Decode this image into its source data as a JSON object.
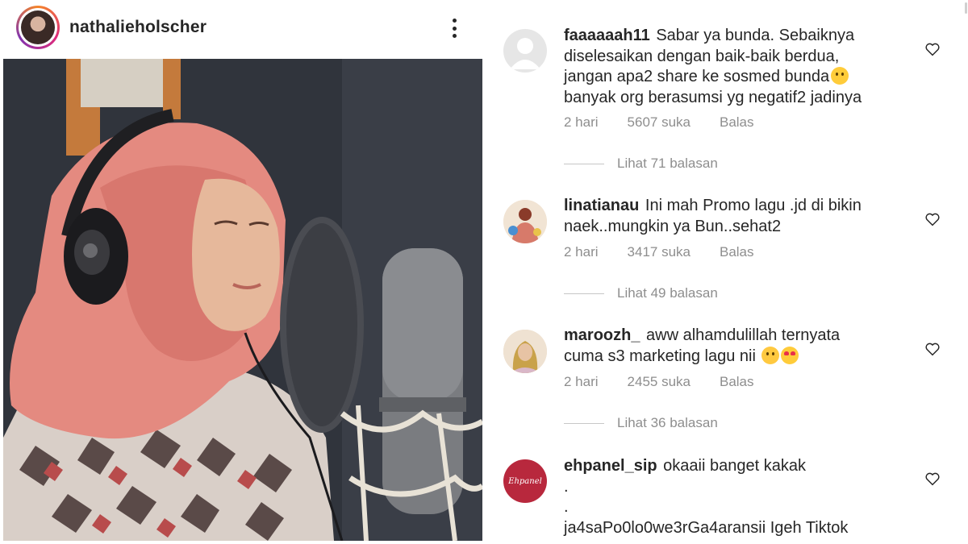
{
  "post": {
    "author": "nathalieholscher",
    "icons": {
      "more": "more-vertical-icon",
      "like": "heart-outline-icon"
    }
  },
  "comments": [
    {
      "user": "faaaaaah11",
      "text_lines": [
        "Sabar ya bunda. Sebaiknya",
        "diselesaikan dengan baik-baik berdua,",
        "jangan apa2 share ke sosmed bunda",
        "banyak org berasumsi yg negatif2 jadinya"
      ],
      "time": "2 hari",
      "likes": "5607 suka",
      "reply": "Balas",
      "view_replies": "Lihat 71 balasan"
    },
    {
      "user": "linatianau",
      "text_lines": [
        "Ini mah Promo lagu .jd di bikin",
        "naek..mungkin ya Bun..sehat2"
      ],
      "time": "2 hari",
      "likes": "3417 suka",
      "reply": "Balas",
      "view_replies": "Lihat 49 balasan"
    },
    {
      "user": "maroozh_",
      "text_lines": [
        "aww alhamdulillah ternyata",
        "cuma s3 marketing lagu nii"
      ],
      "time": "2 hari",
      "likes": "2455 suka",
      "reply": "Balas",
      "view_replies": "Lihat 36 balasan"
    },
    {
      "user": "ehpanel_sip",
      "text_lines": [
        "okaaii banget kakak",
        ".",
        ".",
        "ja4saPo0lo0we3rGa4aransii Igeh Tiktok"
      ],
      "avatar_label": "Ehpanel"
    }
  ],
  "colors": {
    "muted": "#8e8e8e",
    "text": "#262626",
    "ehpanel_avatar": "#b8283d"
  }
}
